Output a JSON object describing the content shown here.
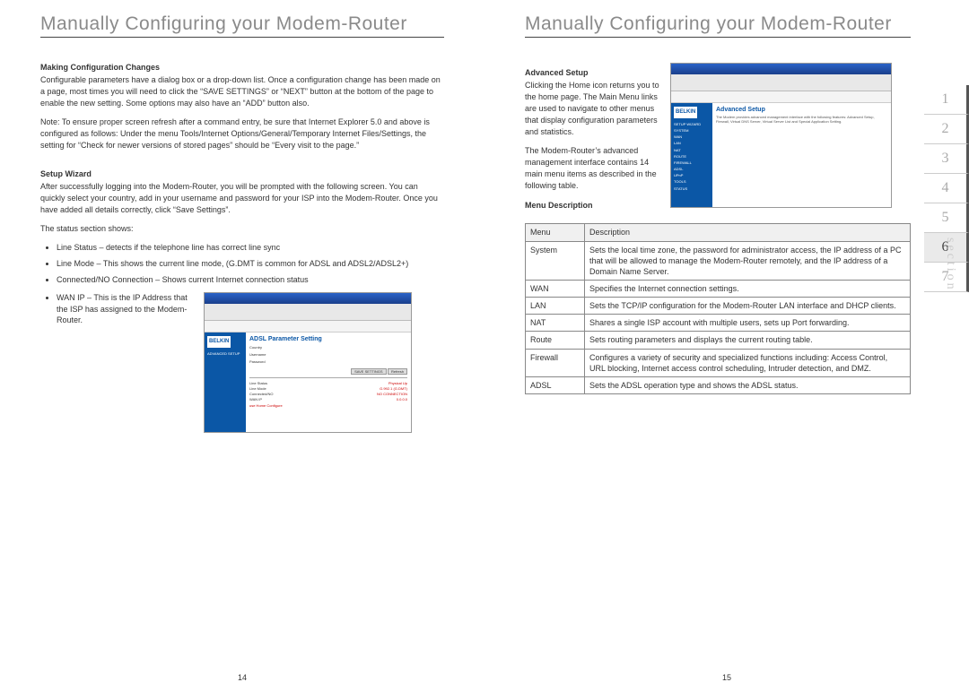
{
  "page_title": "Manually Configuring your Modem-Router",
  "left": {
    "h1": "Making Configuration Changes",
    "p1": "Configurable parameters have a dialog box or a drop-down list. Once a configuration change has been made on a page, most times you will need to click the “SAVE SETTINGS” or “NEXT” button at the bottom of the page to enable the new setting. Some options may also have an “ADD” button also.",
    "p2": "Note:  To ensure proper screen refresh after a command entry, be sure that Internet Explorer 5.0 and above is configured as follows: Under the menu Tools/Internet Options/General/Temporary Internet Files/Settings, the setting for “Check for newer versions of stored pages” should be “Every visit to the page.”",
    "h2": "Setup Wizard",
    "p3": "After successfully logging into the Modem-Router, you will be prompted with the following screen.  You can quickly select your country, add in your username and password for your ISP into the Modem-Router.  Once you have added all details correctly, click “Save Settings”.",
    "p4": "The status section shows:",
    "bullets": [
      "Line Status – detects if the telephone line has correct line sync",
      "Line Mode – This shows the current line mode, (G.DMT is common for ADSL and ADSL2/ADSL2+)",
      "Connected/NO Connection – Shows current Internet connection status",
      "WAN IP – This is the IP Address that the ISP has assigned to the Modem-Router."
    ],
    "ss": {
      "logo": "BELKIN",
      "side_head": "ADVANCED SETUP",
      "head": "ADSL Parameter Setting",
      "fields": [
        "Country",
        "Username",
        "Password"
      ],
      "btns": [
        "SAVE SETTINGS",
        "Refresh"
      ],
      "status": [
        [
          "Line Status",
          "Physical Up"
        ],
        [
          "Line Mode",
          "G.992.1 (G.DMT)"
        ],
        [
          "Connected/NO",
          "NO CONNECTION"
        ],
        [
          "WAN IP",
          "0.0.0.0"
        ]
      ],
      "link": "use Home Configure"
    },
    "page_number": "14"
  },
  "right": {
    "h1": "Advanced Setup",
    "p1": "Clicking the Home icon returns you to the home page. The Main Menu links are used to navigate to other menus that display configuration parameters and statistics.",
    "p2": "The Modem-Router’s advanced management interface contains 14 main menu items as described in the following table.",
    "h2": "Menu Description",
    "ss": {
      "logo": "BELKIN",
      "side_items": [
        "SETUP WIZARD",
        "SYSTEM",
        "WAN",
        "LAN",
        "NAT",
        "ROUTE",
        "FIREWALL",
        "ADSL",
        "UPnP",
        "TOOLS",
        "STATUS"
      ],
      "head": "Advanced Setup",
      "text": "The Modem provides advanced management interface with the following features: Advanced Setup, Firewall, Virtual DNS Server, Virtual Server List and Special Application Setting."
    },
    "table": {
      "head": [
        "Menu",
        "Description"
      ],
      "rows": [
        [
          "System",
          "Sets the local time zone, the password for administrator access, the IP address of a PC that will be allowed to manage the Modem-Router remotely, and the IP address of a Domain Name Server."
        ],
        [
          "WAN",
          "Specifies the Internet connection settings."
        ],
        [
          "LAN",
          "Sets the TCP/IP configuration for the Modem-Router LAN interface and DHCP clients."
        ],
        [
          "NAT",
          "Shares a single ISP account with multiple users, sets up Port forwarding."
        ],
        [
          "Route",
          "Sets routing parameters and displays the current routing table."
        ],
        [
          "Firewall",
          "Configures a variety of security and specialized functions including: Access Control, URL blocking, Internet access control scheduling, Intruder detection, and DMZ."
        ],
        [
          "ADSL",
          "Sets the ADSL operation type and shows the ADSL status."
        ]
      ]
    },
    "page_number": "15"
  },
  "section_tabs": [
    "1",
    "2",
    "3",
    "4",
    "5",
    "6",
    "7"
  ],
  "active_tab": "6",
  "section_word": "section"
}
